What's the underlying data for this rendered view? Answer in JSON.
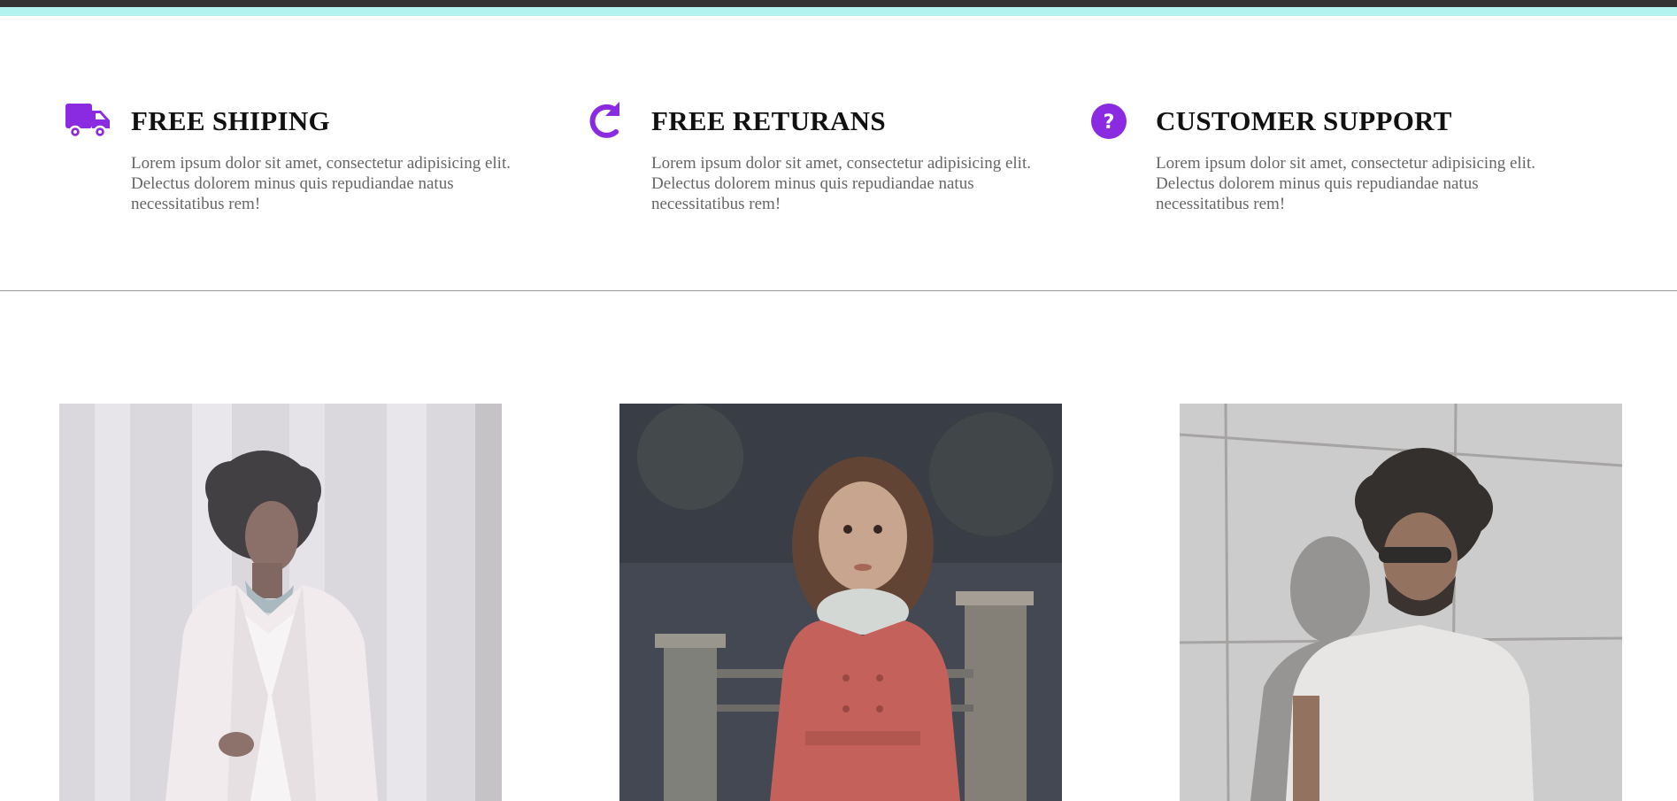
{
  "colors": {
    "topbar": "#333333",
    "accent_bar": "#b2f3ef",
    "icon_purple": "#8a2be2",
    "heading": "#111111",
    "body_text": "#666666",
    "divider": "#999999"
  },
  "features": [
    {
      "icon": "truck-icon",
      "title": "FREE SHIPING",
      "text": "Lorem ipsum dolor sit amet, consectetur adipisicing elit. Delectus dolorem minus quis repudiandae natus necessitatibus rem!"
    },
    {
      "icon": "redo-icon",
      "title": "FREE RETURANS",
      "text": "Lorem ipsum dolor sit amet, consectetur adipisicing elit. Delectus dolorem minus quis repudiandae natus necessitatibus rem!"
    },
    {
      "icon": "question-circle-icon",
      "title": "CUSTOMER SUPPORT",
      "text": "Lorem ipsum dolor sit amet, consectetur adipisicing elit. Delectus dolorem minus quis repudiandae natus necessitatibus rem!"
    }
  ],
  "photos": [
    {
      "subject": "woman in white blazer"
    },
    {
      "subject": "girl in red coat"
    },
    {
      "subject": "man with sunglasses and white t-shirt"
    }
  ]
}
